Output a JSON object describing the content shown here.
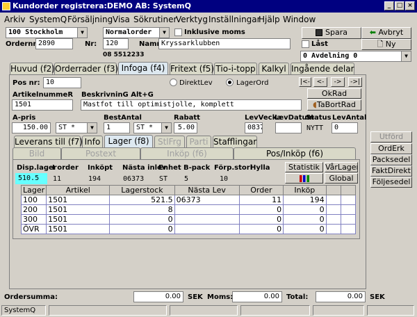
{
  "window": {
    "title": "Kundorder registrera:DEMO AB: SystemQ"
  },
  "menu": [
    "Arkiv",
    "SystemQ",
    "Försäljning",
    "Visa",
    "Sökrutiner",
    "Verktyg",
    "Inställningar",
    "Hjälp",
    "Window"
  ],
  "header": {
    "company_combo": "100   Stockholm",
    "order_type_combo": "Normalorder",
    "inclusive_vat_label": "Inklusive moms",
    "ordernr_label": "Ordernr:",
    "ordernr": "2890",
    "nr_label": "Nr:",
    "nr": "120",
    "namn_label": "Namn:",
    "namn": "Kryssarklubben",
    "phone": "08 5512233",
    "locked_label": "Låst",
    "department_combo": "0  Avdelning 0"
  },
  "buttons": {
    "save": "Spara",
    "cancel": "Avbryt",
    "new": "Ny",
    "okrad": "OkRad",
    "tabortrad": "TaBortRad",
    "statistik": "Statistik",
    "vartlager": "VårLager",
    "global": "Global",
    "utford": "Utförd",
    "orderk": "OrdErk",
    "packsedel": "Packsedel",
    "faktdirekt": "FaktDirekt",
    "foljesedel": "Följesedel",
    "nav": [
      "|<-",
      "<-",
      "->",
      "->|"
    ]
  },
  "tabs": [
    "Huvud (f2)",
    "Orderrader (f3)",
    "Infoga (f4)",
    "Fritext (f5)",
    "Tio-i-topp",
    "Kalkyl",
    "Ingående delar"
  ],
  "subtabs": [
    "Leverans till (f7)",
    "Info",
    "Lager  (f8)",
    "StlFrg",
    "Parti",
    "Stafflingar"
  ],
  "subtabs2": [
    "Bild",
    "Postext",
    "Inköp (f6)",
    "Pos/Inköp (f6)"
  ],
  "row": {
    "posnr_label": "Pos nr:",
    "posnr": "10",
    "direktlev": "DirektLev",
    "lagerord": "LagerOrd",
    "artikel_label": "ArtikelnummeR",
    "artikel": "1501",
    "beskr_label": "BeskrivninG Alt+G",
    "beskr": "Mastfot till optimistjolle, komplett",
    "apris_label": "A-pris",
    "apris": "150.00",
    "unit1": "ST  *",
    "bestantal_label": "BestAntal",
    "bestantal": "1",
    "unit2": "ST  *",
    "rabatt_label": "Rabatt",
    "rabatt": "5.00",
    "levvecka_label": "LevVecka",
    "levvecka": "0837",
    "levdatum_label": "LevDatum",
    "levdatum": "",
    "status_label": "Status",
    "status": "NYTT",
    "levantal_label": "LevAntal",
    "levantal": "0"
  },
  "lager": {
    "disp_label": "Disp.lager",
    "disp": "510.5",
    "iorder_label": "I order",
    "iorder": "11",
    "inkopt_label": "Inköpt",
    "inkopt": "194",
    "nasta_label": "Nästa inlev",
    "nasta": "06373",
    "enhet_label": "Enhet",
    "enhet": "ST",
    "bpack_label": "B-pack",
    "bpack": "5",
    "forp_label": "Förp.storl",
    "forp": "10",
    "hylla_label": "Hylla"
  },
  "table": {
    "headers": [
      "Lager",
      "Artikel",
      "Lagerstock",
      "Nästa Lev",
      "Order",
      "Inköp"
    ],
    "rows": [
      [
        "100",
        "1501",
        "521.5",
        "06373",
        "11",
        "194"
      ],
      [
        "200",
        "1501",
        "8",
        "",
        "0",
        "0"
      ],
      [
        "300",
        "1501",
        "0",
        "",
        "0",
        "0"
      ],
      [
        "ÖVR",
        "1501",
        "0",
        "",
        "0",
        "0"
      ]
    ]
  },
  "footer": {
    "ordersumma_label": "Ordersumma:",
    "ordersumma": "0.00",
    "sek1": "SEK",
    "moms_label": "Moms:",
    "moms": "0.00",
    "total_label": "Total:",
    "total": "0.00",
    "sek2": "SEK",
    "status_app": "SystemQ"
  },
  "colors": {
    "title": "#000080",
    "highlight": "#66ffff"
  }
}
